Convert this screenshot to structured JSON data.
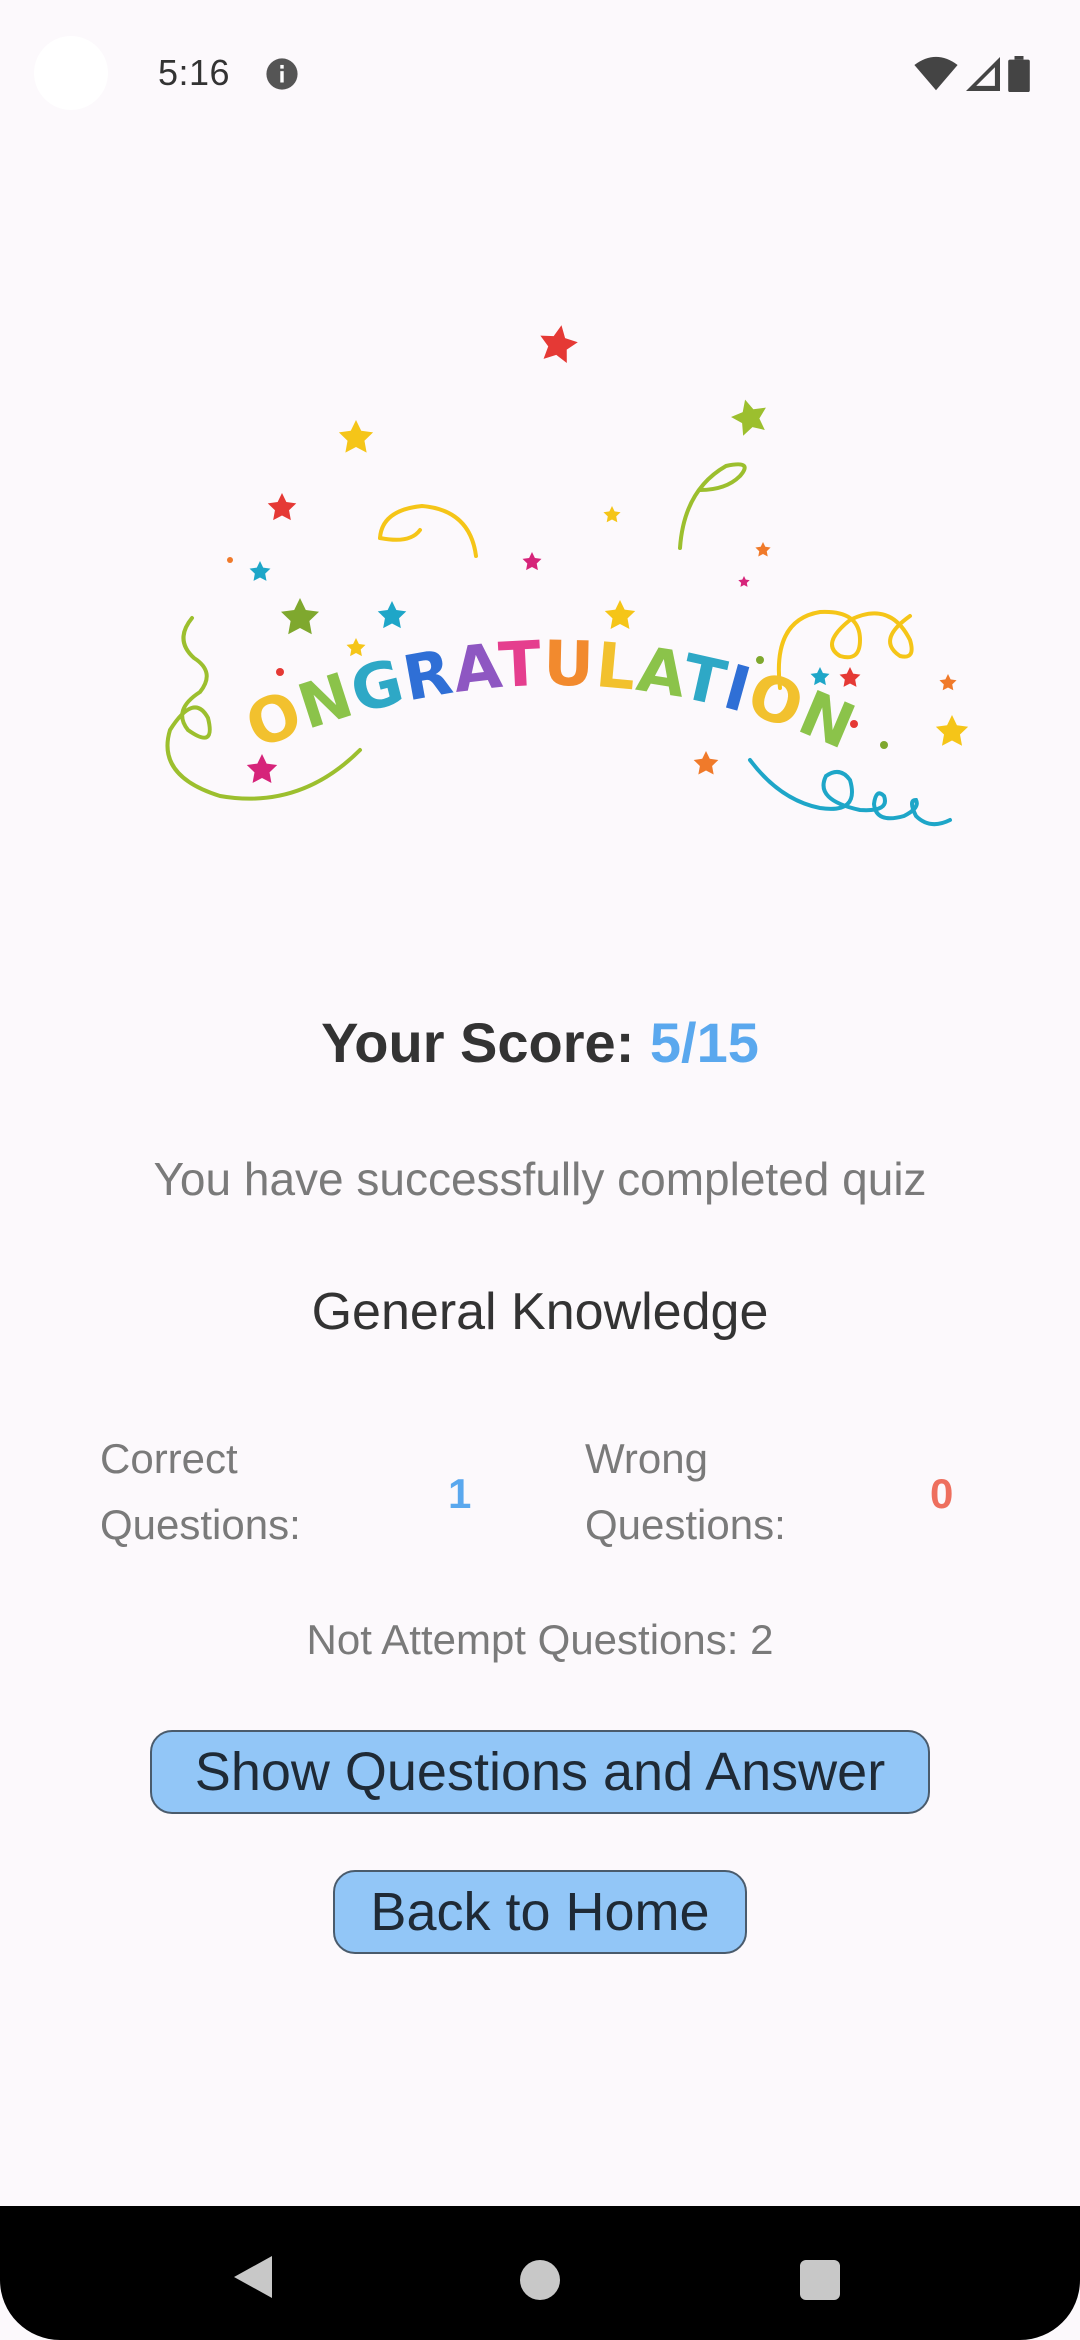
{
  "status_bar": {
    "time": "5:16",
    "icons": [
      "info-icon",
      "wifi-icon",
      "cell-signal-icon",
      "battery-icon"
    ]
  },
  "banner": {
    "text": "CONGRATULATIONS",
    "letter_colors": [
      "#F28A2E",
      "#F2C12E",
      "#8BC34A",
      "#2EA8C6",
      "#2F6FD6",
      "#8E57C2",
      "#E53E8E",
      "#F28A2E",
      "#F2C12E",
      "#8BC34A",
      "#2EA8C6",
      "#2F6FD6",
      "#F2C12E",
      "#8BC34A",
      "#F28A2E"
    ]
  },
  "result": {
    "score_label": "Your Score:",
    "score_value": "5/15",
    "completed_text": "You have successfully completed quiz",
    "quiz_name": "General Knowledge"
  },
  "stats": {
    "correct_label_line1": "Correct",
    "correct_label_line2": "Questions:",
    "correct_value": "1",
    "wrong_label_line1": "Wrong",
    "wrong_label_line2": "Questions:",
    "wrong_value": "0",
    "not_attempt": "Not Attempt Questions: 2"
  },
  "buttons": {
    "show_answers": "Show Questions and Answer",
    "back_home": "Back to Home"
  },
  "colors": {
    "accent_blue": "#5AA8EE",
    "wrong_red": "#EE6F5E",
    "button_bg": "#92C6F7"
  },
  "nav_bar": {
    "icons": [
      "back-icon",
      "home-icon",
      "recents-icon"
    ]
  }
}
